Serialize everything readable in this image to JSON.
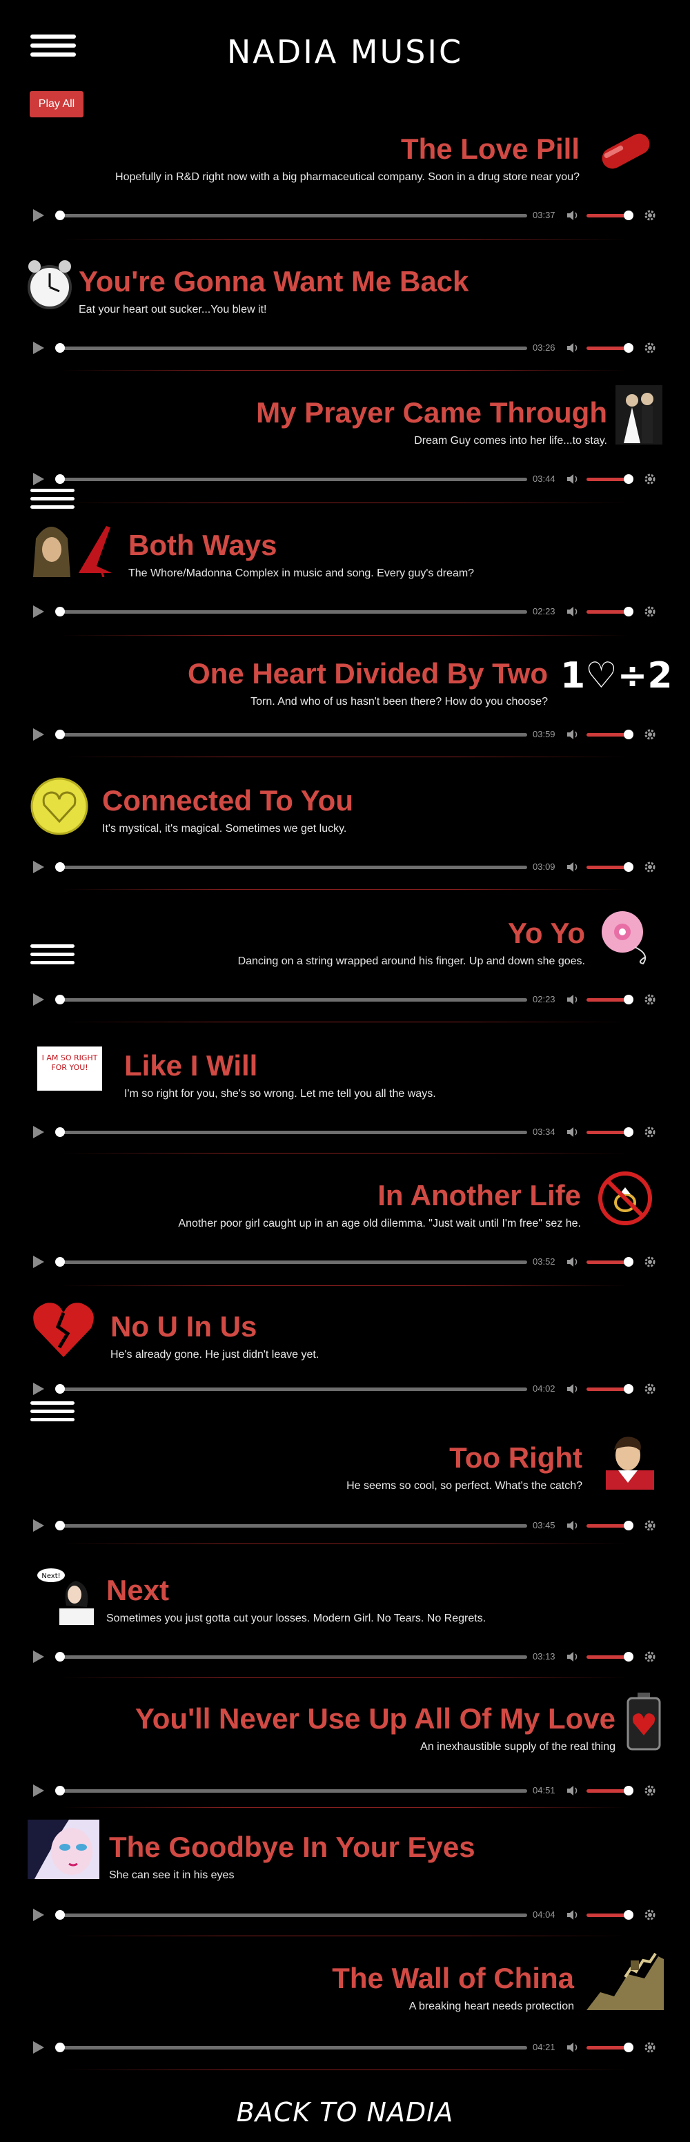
{
  "header": {
    "site_title": "NADIA MUSIC",
    "play_all_label": "Play All"
  },
  "colors": {
    "accent": "#d24a44",
    "background": "#000000",
    "button": "#cf3b3b"
  },
  "tracks": [
    {
      "title": "The Love Pill",
      "description": "Hopefully in R&D right now with a big pharmaceutical company. Soon in a drug store near you?",
      "duration": "03:37",
      "icon": "red-pill-icon"
    },
    {
      "title": "You're Gonna Want Me Back",
      "description": "Eat your heart out sucker...You blew it!",
      "duration": "03:26",
      "icon": "alarm-clock-icon"
    },
    {
      "title": "My Prayer Came Through",
      "description": "Dream Guy comes into her life...to stay.",
      "duration": "03:44",
      "icon": "wedding-couple-icon"
    },
    {
      "title": "Both Ways",
      "description": "The Whore/Madonna Complex in music and song. Every guy's dream?",
      "duration": "02:23",
      "icon": "madonna-heel-icon"
    },
    {
      "title": "One Heart Divided By Two",
      "description": "Torn. And who of us hasn't been there? How do you choose?",
      "duration": "03:59",
      "icon": "heart-division-icon",
      "icon_text": "1♡÷2"
    },
    {
      "title": "Connected To You",
      "description": "It's mystical, it's magical. Sometimes we get lucky.",
      "duration": "03:09",
      "icon": "yellow-heart-button-icon"
    },
    {
      "title": "Yo Yo",
      "description": "Dancing on a string wrapped around his finger. Up and down she goes.",
      "duration": "02:23",
      "icon": "pink-yoyo-icon"
    },
    {
      "title": "Like I Will",
      "description": "I'm so right for you, she's so wrong. Let me tell you all the ways.",
      "duration": "03:34",
      "icon": "sign-icon",
      "icon_text": "I AM SO RIGHT FOR YOU!"
    },
    {
      "title": "In Another Life",
      "description": "Another poor girl caught up in an age old dilemma. \"Just wait until I'm free\" sez he.",
      "duration": "03:52",
      "icon": "no-ring-icon"
    },
    {
      "title": "No U In Us",
      "description": "He's already gone. He just didn't leave yet.",
      "duration": "04:02",
      "icon": "broken-heart-icon"
    },
    {
      "title": "Too Right",
      "description": "He seems so cool, so perfect. What's the catch?",
      "duration": "03:45",
      "icon": "cartoon-man-icon"
    },
    {
      "title": "Next",
      "description": "Sometimes you just gotta cut your losses. Modern Girl. No Tears. No Regrets.",
      "duration": "03:13",
      "icon": "next-girl-icon",
      "icon_text": "Next!"
    },
    {
      "title": "You'll Never Use Up All Of My Love",
      "description": "An inexhaustible supply of the real thing",
      "duration": "04:51",
      "icon": "heart-battery-icon"
    },
    {
      "title": "The Goodbye In Your Eyes",
      "description": "She can see it in his eyes",
      "duration": "04:04",
      "icon": "comic-girl-icon"
    },
    {
      "title": "The Wall of China",
      "description": "A breaking heart needs protection",
      "duration": "04:21",
      "icon": "great-wall-icon"
    }
  ],
  "footer": {
    "back_label": "BACK TO NADIA"
  }
}
